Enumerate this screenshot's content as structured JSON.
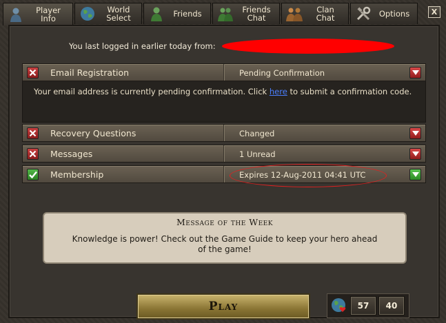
{
  "tabs": [
    {
      "label": "Player\nInfo",
      "icon": "player-icon"
    },
    {
      "label": "World\nSelect",
      "icon": "globe-icon"
    },
    {
      "label": "Friends",
      "icon": "friends-icon"
    },
    {
      "label": "Friends\nChat",
      "icon": "friends-chat-icon"
    },
    {
      "label": "Clan\nChat",
      "icon": "clan-icon"
    },
    {
      "label": "Options",
      "icon": "tools-icon"
    }
  ],
  "close_label": "X",
  "last_login": "You last logged in earlier today from:",
  "rows": [
    {
      "title": "Email Registration",
      "value": "Pending Confirmation",
      "state": "bad",
      "toggle": "red"
    },
    {
      "title": "Recovery Questions",
      "value": "Changed",
      "state": "bad",
      "toggle": "red"
    },
    {
      "title": "Messages",
      "value": "1 Unread",
      "state": "bad",
      "toggle": "red"
    },
    {
      "title": "Membership",
      "value": "Expires 12-Aug-2011 04:41 UTC",
      "state": "good",
      "toggle": "green"
    }
  ],
  "email_detail": {
    "text_before": "Your email address is currently pending confirmation. Click ",
    "link": "here",
    "text_after": " to submit a confirmation code."
  },
  "message_of_week": {
    "heading": "Message of the Week",
    "body": "Knowledge is power! Check out the Game Guide to keep your hero ahead of the game!"
  },
  "play_label": "Play",
  "stats": {
    "first": "57",
    "second": "40"
  }
}
